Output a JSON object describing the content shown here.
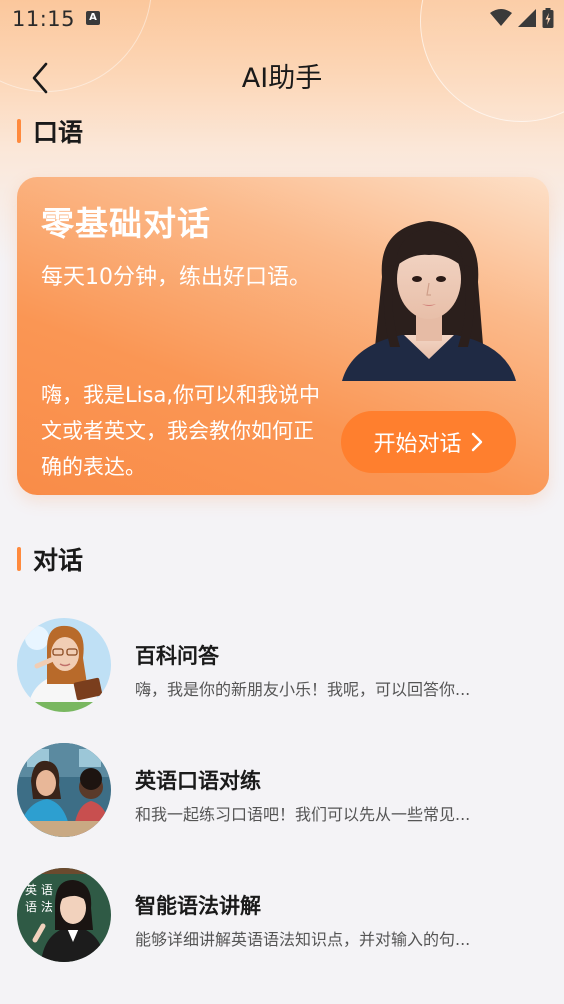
{
  "status_bar": {
    "time": "11:15",
    "a_badge": "A"
  },
  "header": {
    "title": "AI助手",
    "back_icon": "chevron-left-icon"
  },
  "section_oral": {
    "title": "口语"
  },
  "hero": {
    "title": "零基础对话",
    "subtitle": "每天10分钟，练出好口语。",
    "description": "嗨，我是Lisa,你可以和我说中文或者英文，我会教你如何正确的表达。",
    "button_label": "开始对话",
    "accent": "#ff7f2e"
  },
  "section_dialog": {
    "title": "对话"
  },
  "dialogs": [
    {
      "title": "百科问答",
      "desc": "嗨，我是你的新朋友小乐！我呢，可以回答你..."
    },
    {
      "title": "英语口语对练",
      "desc": "和我一起练习口语吧！我们可以先从一些常见..."
    },
    {
      "title": "智能语法讲解",
      "desc": "能够详细讲解英语语法知识点，并对输入的句..."
    }
  ],
  "avatar3_board_text": "英 语\n语 法",
  "colors": {
    "accent": "#ff8a3d",
    "background": "#f4f3f6"
  }
}
